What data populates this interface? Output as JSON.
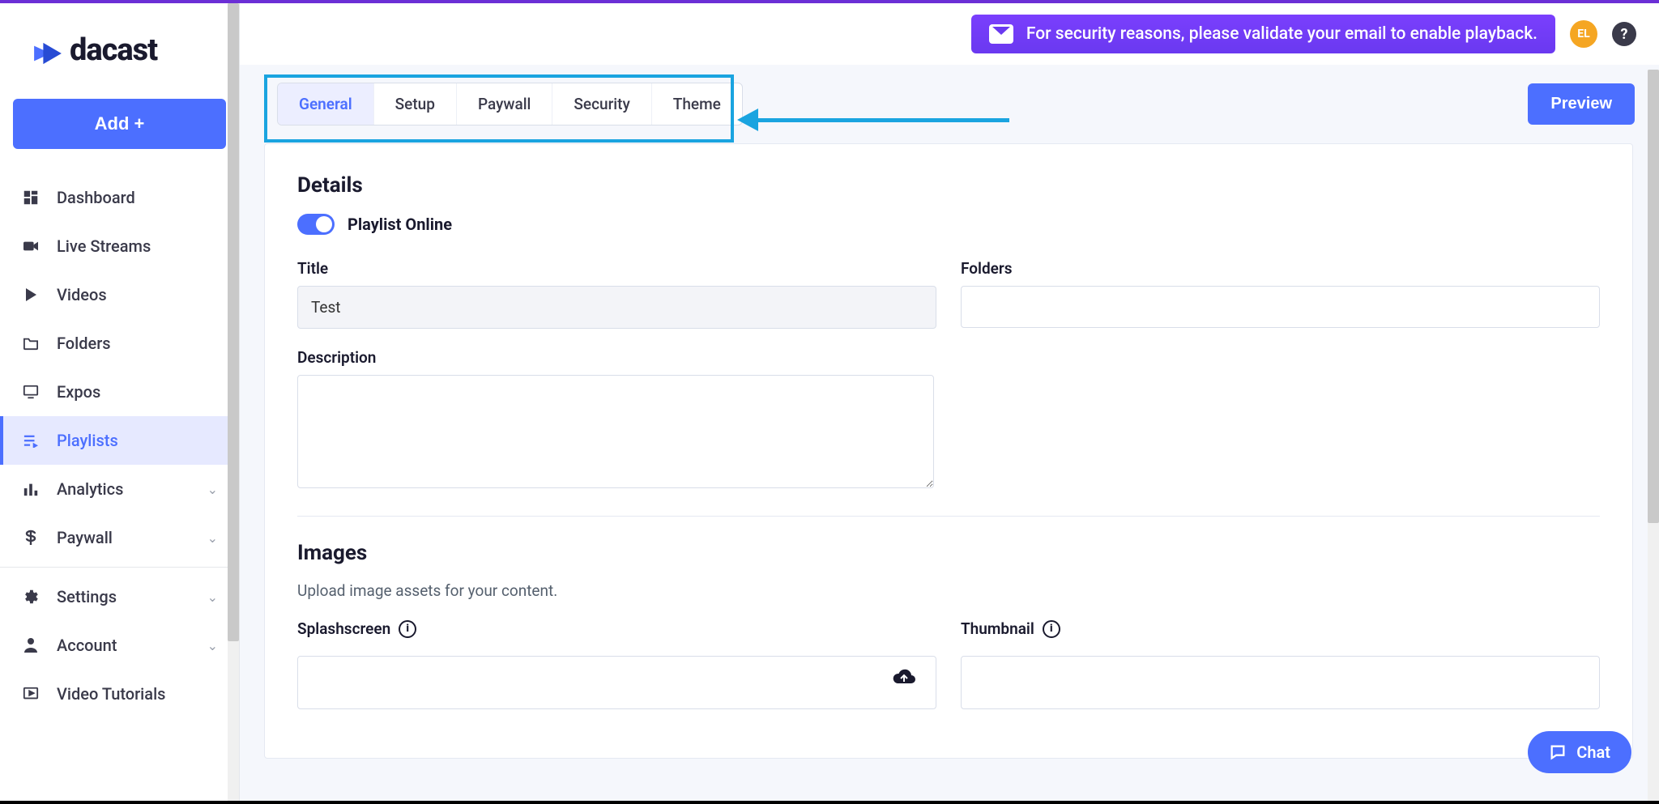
{
  "brand": "dacast",
  "addButton": "Add +",
  "sidebar": {
    "items": [
      {
        "label": "Dashboard",
        "icon": "dashboard-icon"
      },
      {
        "label": "Live Streams",
        "icon": "camera-icon"
      },
      {
        "label": "Videos",
        "icon": "play-icon"
      },
      {
        "label": "Folders",
        "icon": "folder-icon"
      },
      {
        "label": "Expos",
        "icon": "monitor-icon"
      },
      {
        "label": "Playlists",
        "icon": "playlist-icon",
        "active": true
      },
      {
        "label": "Analytics",
        "icon": "bars-icon",
        "chev": true
      },
      {
        "label": "Paywall",
        "icon": "dollar-icon",
        "chev": true
      }
    ],
    "bottom": [
      {
        "label": "Settings",
        "icon": "gear-icon",
        "chev": true
      },
      {
        "label": "Account",
        "icon": "user-icon",
        "chev": true
      },
      {
        "label": "Video Tutorials",
        "icon": "video-box-icon"
      }
    ]
  },
  "banner": "For security reasons, please validate your email to enable playback.",
  "avatar": "EL",
  "tabs": [
    "General",
    "Setup",
    "Paywall",
    "Security",
    "Theme"
  ],
  "activeTab": "General",
  "previewBtn": "Preview",
  "details": {
    "heading": "Details",
    "toggleLabel": "Playlist Online",
    "titleLabel": "Title",
    "titleValue": "Test",
    "foldersLabel": "Folders",
    "foldersValue": "",
    "descLabel": "Description",
    "descValue": ""
  },
  "images": {
    "heading": "Images",
    "subtext": "Upload image assets for your content.",
    "splashLabel": "Splashscreen",
    "thumbLabel": "Thumbnail"
  },
  "chat": "Chat"
}
